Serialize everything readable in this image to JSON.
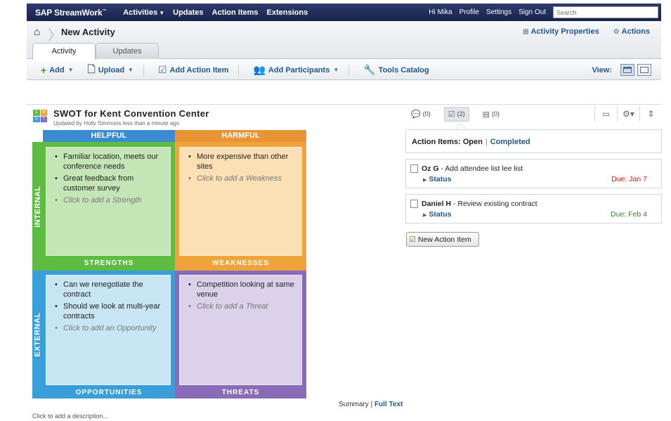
{
  "topbar": {
    "brand": "SAP StreamWork",
    "brand_mark": "™",
    "nav": [
      {
        "label": "Activities",
        "dropdown": true
      },
      {
        "label": "Updates",
        "dropdown": false
      },
      {
        "label": "Action Items",
        "dropdown": false
      },
      {
        "label": "Extensions",
        "dropdown": false
      }
    ],
    "greeting": "Hi Mika",
    "links": [
      "Profile",
      "Settings",
      "Sign Out"
    ],
    "search_placeholder": "Search"
  },
  "header": {
    "home_icon": "home-icon",
    "title": "New Activity",
    "activity_properties": "Activity Properties",
    "actions": "Actions",
    "tabs": [
      {
        "label": "Activity",
        "active": true
      },
      {
        "label": "Updates",
        "active": false
      }
    ]
  },
  "toolbar": {
    "add": "Add",
    "upload": "Upload",
    "add_action_item": "Add Action Item",
    "add_participants": "Add Participants",
    "tools_catalog": "Tools Catalog",
    "view_label": "View:"
  },
  "swot": {
    "logo_letters": [
      "S",
      "W",
      "O",
      "T"
    ],
    "title": "SWOT for Kent Convention Center",
    "subtitle": "Updated by Holly Simmons less than a minute ago",
    "col_headers": {
      "helpful": "HELPFUL",
      "harmful": "HARMFUL"
    },
    "row_headers": {
      "internal": "INTERNAL",
      "external": "EXTERNAL"
    },
    "strengths": {
      "label": "STRENGTHS",
      "items": [
        "Familiar location, meets our conference needs",
        "Great feedback from customer survey"
      ],
      "hint": "Click to add a Strength"
    },
    "weaknesses": {
      "label": "WEAKNESSES",
      "items": [
        "More expensive than other sites"
      ],
      "hint": "Click to add a Weakness"
    },
    "opportunities": {
      "label": "OPPORTUNITIES",
      "items": [
        "Can we renegotiate the contract",
        "Should we look at multi-year contracts"
      ],
      "hint": "Click to add an Opportunity"
    },
    "threats": {
      "label": "THREATS",
      "items": [
        "Competition looking at same venue"
      ],
      "hint": "Click to add a Threat"
    },
    "summary_label": "Summary",
    "fulltext_label": "Full Text",
    "description_hint": "Click to add a description..."
  },
  "right_panel": {
    "tabs": [
      {
        "count": "(0)",
        "icon": "comment-icon"
      },
      {
        "count": "(2)",
        "icon": "action-item-icon"
      },
      {
        "count": "(0)",
        "icon": "decision-icon"
      }
    ],
    "filter_label": "Action Items:",
    "filter_open": "Open",
    "filter_completed": "Completed",
    "items": [
      {
        "owner": "Oz G",
        "text": "Add attendee list   lee list",
        "status": "Status",
        "due": "Due: Jan 7",
        "due_color": "#dd1111"
      },
      {
        "owner": "Daniel H",
        "text": "Review existing contract",
        "status": "Status",
        "due": "Due: Feb 4",
        "due_color": "#2b8a1f"
      }
    ],
    "new_button": "New Action Item"
  },
  "colors": {
    "topbar": "#1e2a56",
    "link": "#21578b",
    "helpful": "#3a8bd0",
    "harmful": "#e89434",
    "strengths_bg": "#c4e6b6",
    "strengths_border": "#5dbd42",
    "weaknesses_bg": "#fbe0b6",
    "weaknesses_border": "#f0a33b",
    "opportunities_bg": "#c8e5f4",
    "opportunities_border": "#3a9fd8",
    "threats_bg": "#dcd1ea",
    "threats_border": "#8a6bb7"
  }
}
